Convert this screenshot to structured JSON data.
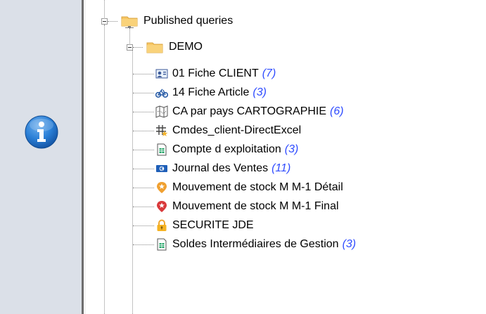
{
  "tree": {
    "root": {
      "label": "Published queries"
    },
    "folder": {
      "label": "DEMO"
    },
    "items": [
      {
        "label": "01 Fiche CLIENT",
        "count": "(7)",
        "icon": "contact-card-icon"
      },
      {
        "label": "14 Fiche Article",
        "count": "(3)",
        "icon": "bicycle-icon"
      },
      {
        "label": "CA par pays CARTOGRAPHIE",
        "count": "(6)",
        "icon": "map-icon"
      },
      {
        "label": "Cmdes_client-DirectExcel",
        "count": "",
        "icon": "grid-star-icon"
      },
      {
        "label": "Compte d exploitation",
        "count": "(3)",
        "icon": "spreadsheet-icon"
      },
      {
        "label": "Journal des Ventes",
        "count": "(11)",
        "icon": "banknote-euro-icon"
      },
      {
        "label": "Mouvement de stock M M-1 Détail",
        "count": "",
        "icon": "star-badge-orange-icon"
      },
      {
        "label": "Mouvement de stock M M-1 Final",
        "count": "",
        "icon": "star-badge-red-icon"
      },
      {
        "label": "SECURITE JDE",
        "count": "",
        "icon": "padlock-icon"
      },
      {
        "label": "Soldes Intermédiaires de Gestion",
        "count": "(3)",
        "icon": "spreadsheet-icon"
      }
    ]
  },
  "colors": {
    "count_text": "#2f4cff",
    "folder_yellow": "#f7c663",
    "info_blue": "#1f6fc6"
  }
}
